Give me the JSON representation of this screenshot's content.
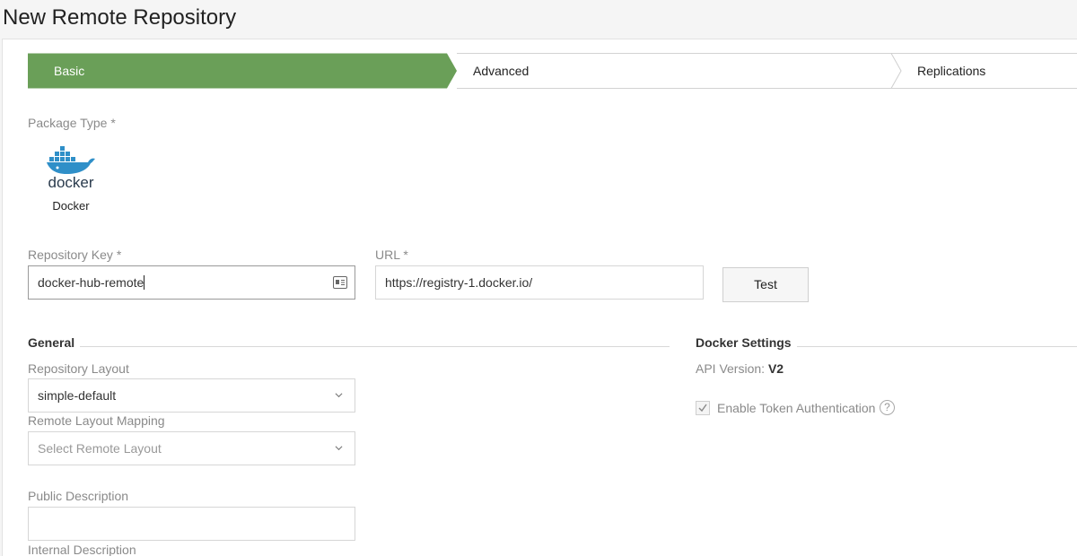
{
  "page": {
    "title": "New Remote Repository"
  },
  "wizard": {
    "steps": [
      {
        "label": "Basic",
        "active": true
      },
      {
        "label": "Advanced",
        "active": false
      },
      {
        "label": "Replications",
        "active": false
      }
    ],
    "active_color": "#6a9f58"
  },
  "package_type": {
    "label": "Package Type *",
    "logo_text": "docker",
    "name": "Docker",
    "icon": "docker-whale-icon"
  },
  "repository_key": {
    "label": "Repository Key *",
    "value": "docker-hub-remote",
    "icon": "id-card-icon"
  },
  "url": {
    "label": "URL *",
    "value": "https://registry-1.docker.io/"
  },
  "test_button": {
    "label": "Test"
  },
  "general": {
    "title": "General",
    "repository_layout": {
      "label": "Repository Layout",
      "value": "simple-default"
    },
    "remote_layout_mapping": {
      "label": "Remote Layout Mapping",
      "placeholder": "Select Remote Layout"
    },
    "public_description": {
      "label": "Public Description",
      "value": ""
    },
    "internal_description": {
      "label": "Internal Description"
    }
  },
  "docker_settings": {
    "title": "Docker Settings",
    "api_version_label": "API Version:",
    "api_version_value": "V2",
    "enable_token_auth": {
      "label": "Enable Token Authentication",
      "checked": true
    },
    "help_icon": "question-circle-icon"
  }
}
